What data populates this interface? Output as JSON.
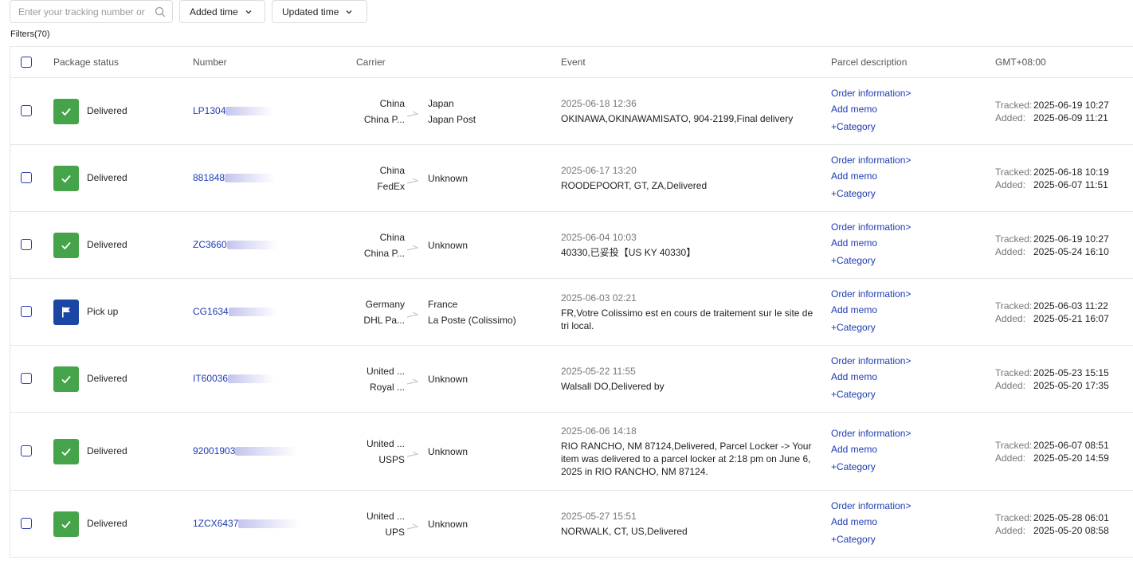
{
  "toolbar": {
    "search_placeholder": "Enter your tracking number or",
    "added_time_label": "Added time",
    "updated_time_label": "Updated time"
  },
  "filters_label": "Filters(70)",
  "columns": {
    "status": "Package status",
    "number": "Number",
    "carrier": "Carrier",
    "event": "Event",
    "parcel": "Parcel description",
    "tz": "GMT+08:00"
  },
  "labels": {
    "order_info": "Order information>",
    "add_memo": "Add memo",
    "category": "+Category",
    "tracked": "Tracked:",
    "added": "Added:"
  },
  "rows": [
    {
      "status": "Delivered",
      "status_icon": "check-icon",
      "status_color": "#45a34a",
      "number": "LP1304",
      "from_country": "China",
      "from_carrier": "China P...",
      "to_country": "Japan",
      "to_carrier": "Japan Post",
      "event_time": "2025-06-18 12:36",
      "event_desc": "OKINAWA,OKINAWAMISATO, 904-2199,Final delivery",
      "tracked": "2025-06-19 10:27",
      "added": "2025-06-09 11:21"
    },
    {
      "status": "Delivered",
      "status_icon": "check-icon",
      "status_color": "#45a34a",
      "number": "881848",
      "from_country": "China",
      "from_carrier": "FedEx",
      "to_country": "",
      "to_carrier": "Unknown",
      "event_time": "2025-06-17 13:20",
      "event_desc": "ROODEPOORT, GT, ZA,Delivered",
      "tracked": "2025-06-18 10:19",
      "added": "2025-06-07 11:51"
    },
    {
      "status": "Delivered",
      "status_icon": "check-icon",
      "status_color": "#45a34a",
      "number": "ZC3660",
      "from_country": "China",
      "from_carrier": "China P...",
      "to_country": "",
      "to_carrier": "Unknown",
      "event_time": "2025-06-04 10:03",
      "event_desc": "40330,已妥投【US KY 40330】",
      "tracked": "2025-06-19 10:27",
      "added": "2025-05-24 16:10"
    },
    {
      "status": "Pick up",
      "status_icon": "flag-icon",
      "status_color": "#1b46a3",
      "number": "CG1634",
      "from_country": "Germany",
      "from_carrier": "DHL Pa...",
      "to_country": "France",
      "to_carrier": "La Poste (Colissimo)",
      "event_time": "2025-06-03 02:21",
      "event_desc": "FR,Votre Colissimo est en cours de traitement sur le site de tri local.",
      "tracked": "2025-06-03 11:22",
      "added": "2025-05-21 16:07"
    },
    {
      "status": "Delivered",
      "status_icon": "check-icon",
      "status_color": "#45a34a",
      "number": "IT60036",
      "from_country": "United ...",
      "from_carrier": "Royal ...",
      "to_country": "",
      "to_carrier": "Unknown",
      "event_time": "2025-05-22 11:55",
      "event_desc": "Walsall DO,Delivered by",
      "tracked": "2025-05-23 15:15",
      "added": "2025-05-20 17:35"
    },
    {
      "status": "Delivered",
      "status_icon": "check-icon",
      "status_color": "#45a34a",
      "number": "92001903",
      "from_country": "United ...",
      "from_carrier": "USPS",
      "to_country": "",
      "to_carrier": "Unknown",
      "event_time": "2025-06-06 14:18",
      "event_desc": "RIO RANCHO, NM 87124,Delivered, Parcel Locker -> Your item was delivered to a parcel locker at 2:18 pm on June 6, 2025 in RIO RANCHO, NM 87124.",
      "tracked": "2025-06-07 08:51",
      "added": "2025-05-20 14:59"
    },
    {
      "status": "Delivered",
      "status_icon": "check-icon",
      "status_color": "#45a34a",
      "number": "1ZCX6437",
      "from_country": "United ...",
      "from_carrier": "UPS",
      "to_country": "",
      "to_carrier": "Unknown",
      "event_time": "2025-05-27 15:51",
      "event_desc": "NORWALK, CT, US,Delivered",
      "tracked": "2025-05-28 06:01",
      "added": "2025-05-20 08:58"
    }
  ]
}
